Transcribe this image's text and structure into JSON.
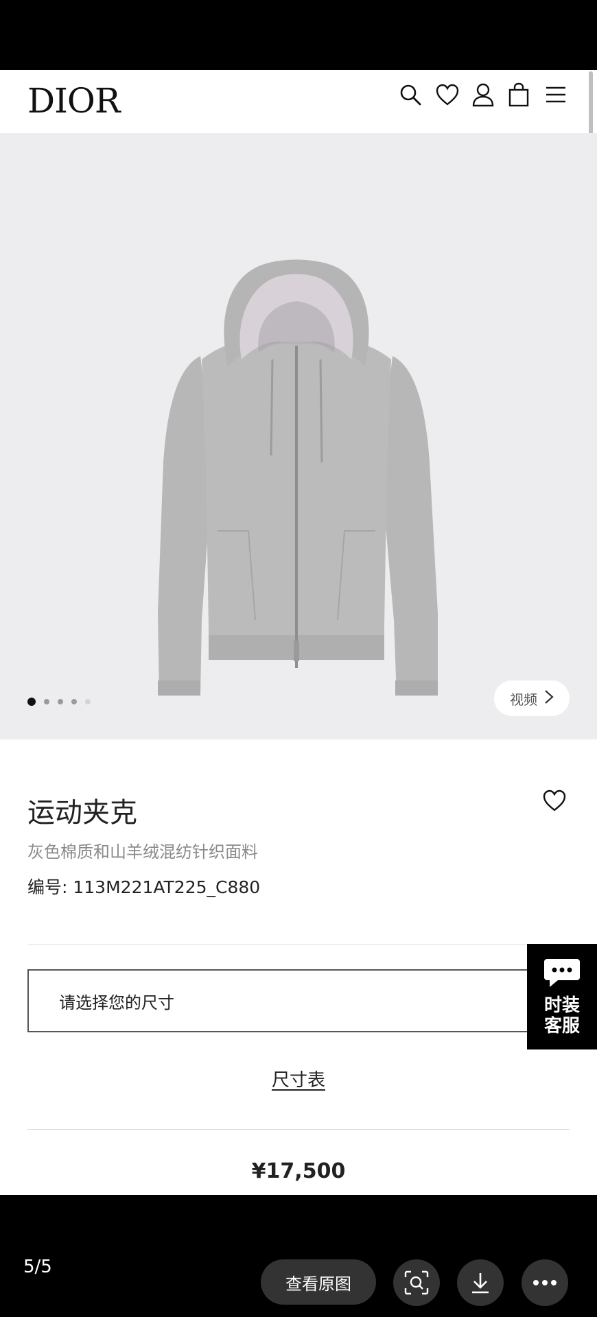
{
  "header": {
    "logo": "DIOR",
    "icons": [
      "search-icon",
      "heart-icon",
      "user-icon",
      "bag-icon",
      "menu-icon"
    ]
  },
  "hero": {
    "video_label": "视频",
    "carousel": {
      "count": 5,
      "active_index": 0
    }
  },
  "product": {
    "title": "运动夹克",
    "subtitle": "灰色棉质和山羊绒混纺针织面料",
    "code": "编号: 113M221AT225_C880",
    "size_placeholder": "请选择您的尺寸",
    "size_chart_label": "尺寸表",
    "price": "¥17,500"
  },
  "chat": {
    "label": "时装客服"
  },
  "viewer": {
    "counter": "5/5",
    "view_original_label": "查看原图"
  },
  "colors": {
    "hero_bg": "#ededef",
    "jacket": "#b9b9b9",
    "hood_lining": "#d8d2d8"
  }
}
